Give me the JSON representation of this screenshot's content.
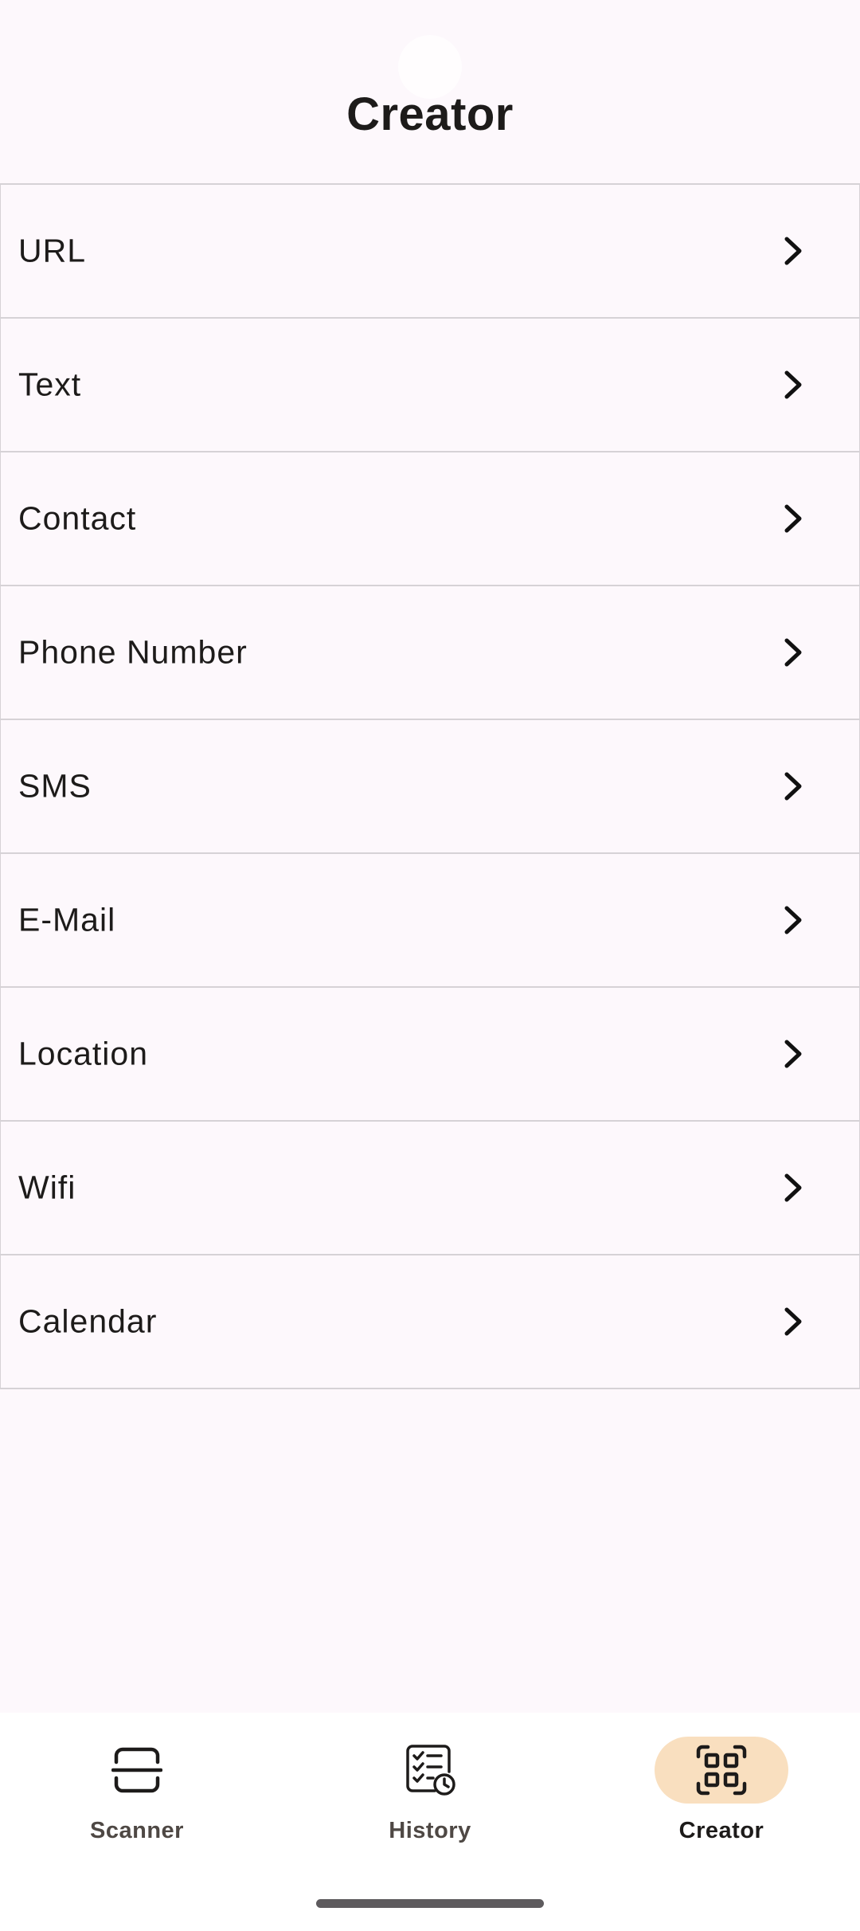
{
  "header": {
    "title": "Creator"
  },
  "creator_options": [
    {
      "label": "URL"
    },
    {
      "label": "Text"
    },
    {
      "label": "Contact"
    },
    {
      "label": "Phone Number"
    },
    {
      "label": "SMS"
    },
    {
      "label": "E-Mail"
    },
    {
      "label": "Location"
    },
    {
      "label": "Wifi"
    },
    {
      "label": "Calendar"
    }
  ],
  "bottom_nav": {
    "active": "Creator",
    "items": [
      {
        "label": "Scanner",
        "icon": "scan-frame-icon"
      },
      {
        "label": "History",
        "icon": "checklist-clock-icon"
      },
      {
        "label": "Creator",
        "icon": "qr-code-icon"
      }
    ]
  },
  "colors": {
    "background": "#fdf8fc",
    "divider": "#d6d2d6",
    "text": "#1d1b1a",
    "active_indicator": "#f9dfbf"
  }
}
